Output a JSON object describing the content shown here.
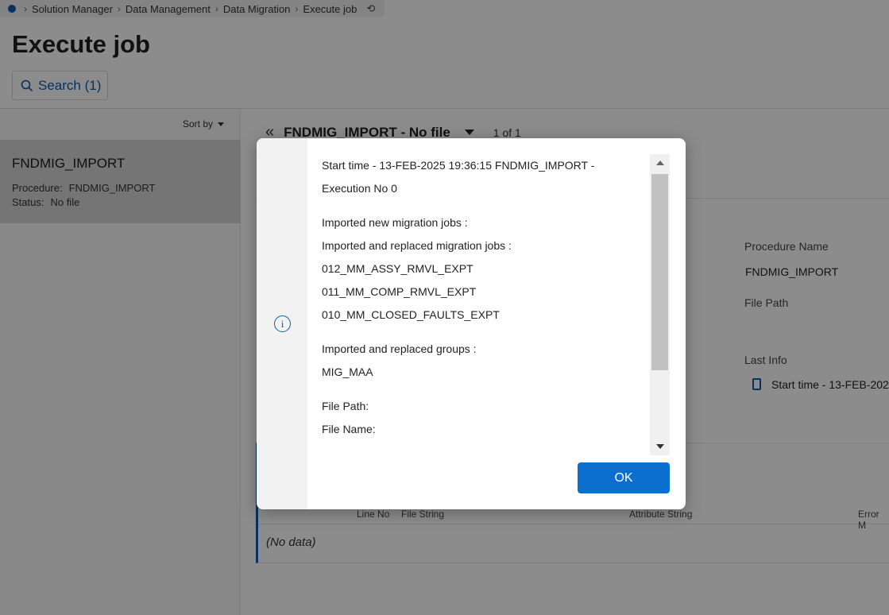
{
  "breadcrumb": {
    "items": [
      "Solution Manager",
      "Data Management",
      "Data Migration",
      "Execute job"
    ]
  },
  "page": {
    "title": "Execute job",
    "search_label": "Search (1)"
  },
  "list": {
    "sort_label": "Sort by",
    "items": [
      {
        "title": "FNDMIG_IMPORT",
        "procedure_label": "Procedure:",
        "procedure_value": "FNDMIG_IMPORT",
        "status_label": "Status:",
        "status_value": "No file"
      }
    ]
  },
  "record": {
    "title": "FNDMIG_IMPORT - No file",
    "count": "1 of 1",
    "fields": {
      "procedure_name_label": "Procedure Name",
      "procedure_name_value": "FNDMIG_IMPORT",
      "file_path_label": "File Path",
      "last_info_label": "Last Info",
      "last_info_value": "Start time - 13-FEB-202"
    }
  },
  "grid": {
    "columns": [
      "Line No",
      "File String",
      "Attribute String",
      "Error M"
    ],
    "empty_text": "(No data)"
  },
  "dialog": {
    "lines": [
      "Start time - 13-FEB-2025 19:36:15 FNDMIG_IMPORT -",
      "Execution No 0",
      "",
      "Imported new migration jobs :",
      "Imported and replaced migration jobs :",
      "012_MM_ASSY_RMVL_EXPT",
      "011_MM_COMP_RMVL_EXPT",
      "010_MM_CLOSED_FAULTS_EXPT",
      "",
      "Imported and replaced groups :",
      "MIG_MAA",
      "",
      "File Path:",
      "File Name:"
    ],
    "ok_label": "OK"
  },
  "colors": {
    "accent": "#0b6fd0",
    "brand": "#0b5cad"
  }
}
